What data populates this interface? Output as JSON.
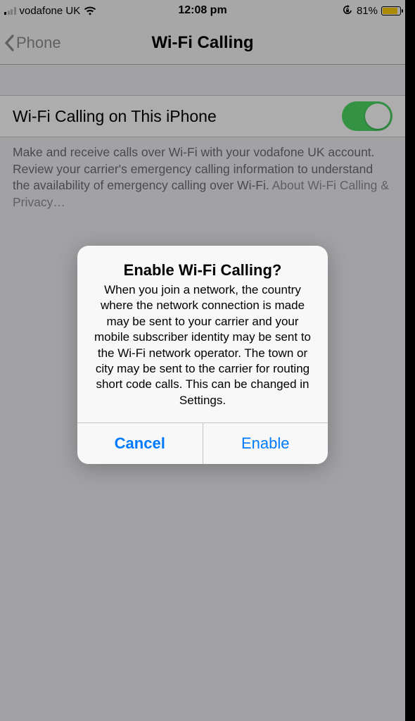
{
  "status": {
    "carrier": "vodafone UK",
    "time": "12:08 pm",
    "battery_pct": "81%"
  },
  "nav": {
    "back_label": "Phone",
    "title": "Wi-Fi Calling"
  },
  "setting": {
    "row_label": "Wi-Fi Calling on This iPhone",
    "footer_main": "Make and receive calls over Wi-Fi with your vodafone UK account. Review your carrier's emergency calling information to understand the availability of emergency calling over Wi-Fi. ",
    "footer_link": "About Wi-Fi Calling & Privacy…"
  },
  "alert": {
    "title": "Enable Wi-Fi Calling?",
    "message": "When you join a network, the country where the network connection is made may be sent to your carrier and your mobile subscriber identity may be sent to the Wi-Fi network operator. The town or city may be sent to the carrier for routing short code calls. This can be changed in Settings.",
    "cancel": "Cancel",
    "confirm": "Enable"
  }
}
